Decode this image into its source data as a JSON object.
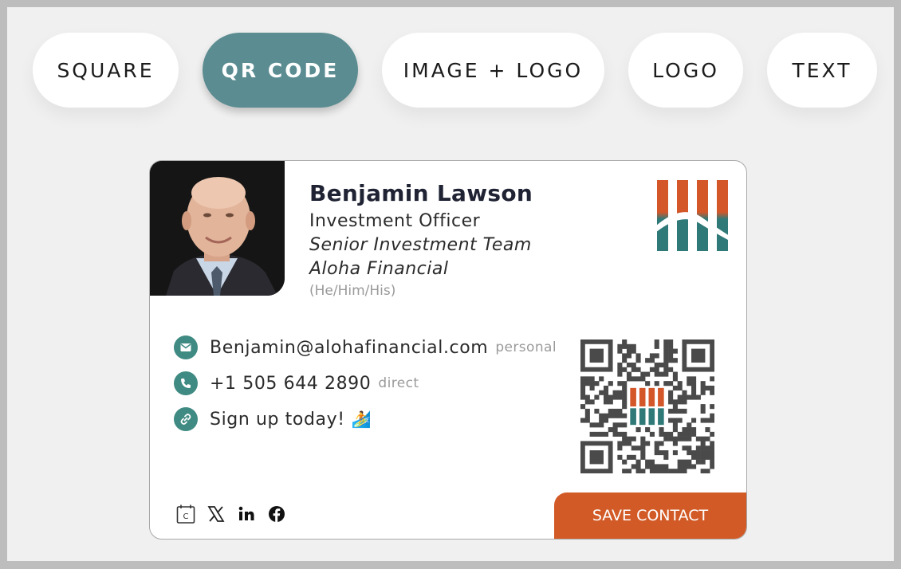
{
  "tabs": [
    {
      "label": "SQUARE",
      "active": false
    },
    {
      "label": "QR CODE",
      "active": true
    },
    {
      "label": "IMAGE + LOGO",
      "active": false
    },
    {
      "label": "LOGO",
      "active": false
    },
    {
      "label": "TEXT",
      "active": false
    }
  ],
  "card": {
    "name": "Benjamin Lawson",
    "title": "Investment Officer",
    "department": "Senior Investment Team",
    "company": "Aloha Financial",
    "pronouns": "(He/Him/His)",
    "contacts": [
      {
        "icon": "email-icon",
        "text": "Benjamin@alohafinancial.com",
        "tag": "personal"
      },
      {
        "icon": "phone-icon",
        "text": "+1 505 644 2890",
        "tag": "direct"
      },
      {
        "icon": "link-icon",
        "text": "Sign up today!",
        "emoji": "🏄"
      }
    ],
    "socials": [
      "calendar-icon",
      "x-icon",
      "linkedin-icon",
      "facebook-icon"
    ],
    "save_label": "SAVE CONTACT"
  },
  "colors": {
    "active_tab": "#5a8c91",
    "icon_circle": "#3f8a82",
    "save_button": "#d25a26",
    "logo_orange": "#d4572a",
    "logo_teal": "#2f7a78"
  }
}
